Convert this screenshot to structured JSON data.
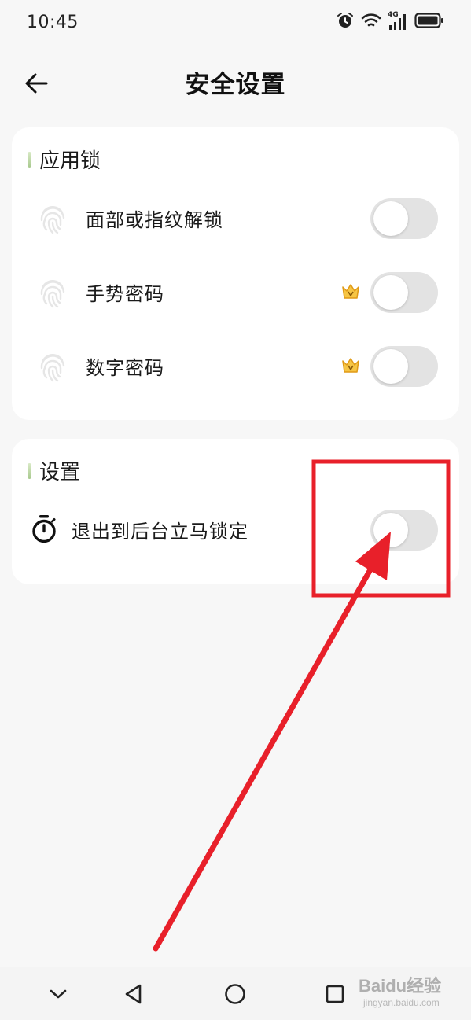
{
  "status_bar": {
    "time": "10:45",
    "network": "4G",
    "icons": [
      "alarm-icon",
      "wifi-icon",
      "signal-icon",
      "battery-icon"
    ]
  },
  "header": {
    "title": "安全设置",
    "back_icon": "arrow-left-icon"
  },
  "app_lock": {
    "title": "应用锁",
    "items": [
      {
        "label": "面部或指纹解锁",
        "icon": "fingerprint-icon",
        "vip": false,
        "enabled": false
      },
      {
        "label": "手势密码",
        "icon": "fingerprint-icon",
        "vip": true,
        "enabled": false
      },
      {
        "label": "数字密码",
        "icon": "fingerprint-icon",
        "vip": true,
        "enabled": false
      }
    ]
  },
  "settings": {
    "title": "设置",
    "items": [
      {
        "label": "退出到后台立马锁定",
        "icon": "stopwatch-icon",
        "enabled": false
      }
    ]
  },
  "nav_bar": {
    "buttons": [
      "chevron-down-icon",
      "back-triangle-icon",
      "home-circle-icon",
      "recents-square-icon"
    ]
  },
  "watermark": {
    "brand": "Baidu经验",
    "url": "jingyan.baidu.com"
  },
  "colors": {
    "accent_bar": "#a8c98e",
    "toggle_off": "#e3e3e3",
    "annotation": "#e8202a",
    "vip_crown": "#f0b429"
  }
}
